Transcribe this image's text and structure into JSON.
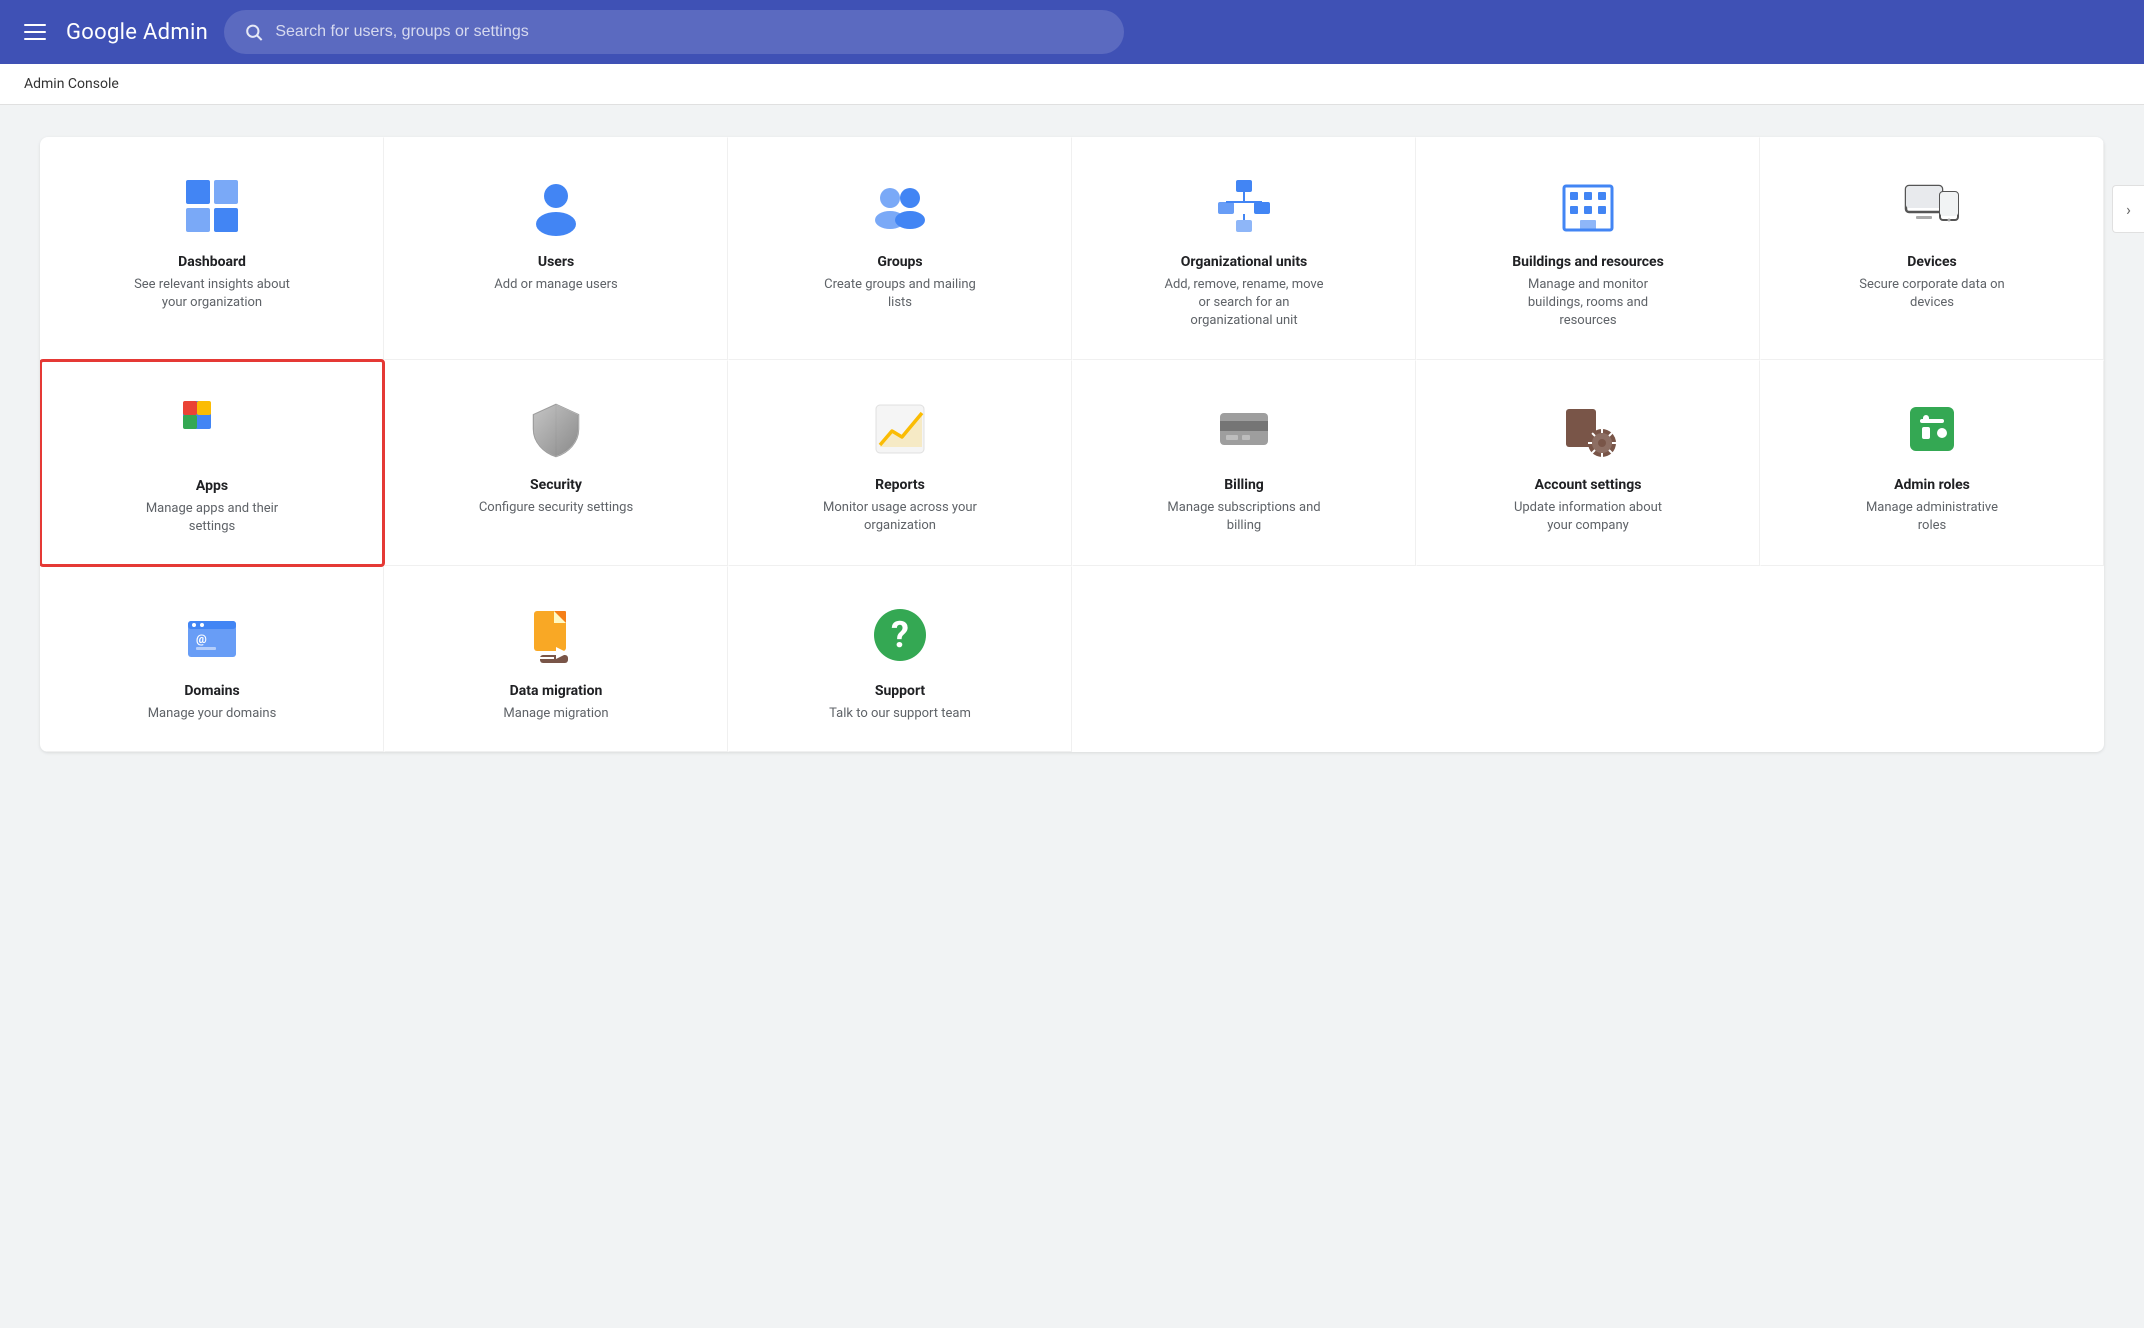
{
  "header": {
    "menu_label": "Menu",
    "logo": "Google Admin",
    "search_placeholder": "Search for users, groups or settings"
  },
  "breadcrumb": "Admin Console",
  "chevron": "›",
  "grid": {
    "items": [
      {
        "id": "dashboard",
        "title": "Dashboard",
        "desc": "See relevant insights about your organization",
        "selected": false,
        "icon": "dashboard"
      },
      {
        "id": "users",
        "title": "Users",
        "desc": "Add or manage users",
        "selected": false,
        "icon": "users"
      },
      {
        "id": "groups",
        "title": "Groups",
        "desc": "Create groups and mailing lists",
        "selected": false,
        "icon": "groups"
      },
      {
        "id": "org-units",
        "title": "Organizational units",
        "desc": "Add, remove, rename, move or search for an organizational unit",
        "selected": false,
        "icon": "org-units"
      },
      {
        "id": "buildings",
        "title": "Buildings and resources",
        "desc": "Manage and monitor buildings, rooms and resources",
        "selected": false,
        "icon": "buildings"
      },
      {
        "id": "devices",
        "title": "Devices",
        "desc": "Secure corporate data on devices",
        "selected": false,
        "icon": "devices"
      },
      {
        "id": "apps",
        "title": "Apps",
        "desc": "Manage apps and their settings",
        "selected": true,
        "icon": "apps"
      },
      {
        "id": "security",
        "title": "Security",
        "desc": "Configure security settings",
        "selected": false,
        "icon": "security"
      },
      {
        "id": "reports",
        "title": "Reports",
        "desc": "Monitor usage across your organization",
        "selected": false,
        "icon": "reports"
      },
      {
        "id": "billing",
        "title": "Billing",
        "desc": "Manage subscriptions and billing",
        "selected": false,
        "icon": "billing"
      },
      {
        "id": "account-settings",
        "title": "Account settings",
        "desc": "Update information about your company",
        "selected": false,
        "icon": "account-settings"
      },
      {
        "id": "admin-roles",
        "title": "Admin roles",
        "desc": "Manage administrative roles",
        "selected": false,
        "icon": "admin-roles"
      },
      {
        "id": "domains",
        "title": "Domains",
        "desc": "Manage your domains",
        "selected": false,
        "icon": "domains"
      },
      {
        "id": "data-migration",
        "title": "Data migration",
        "desc": "Manage migration",
        "selected": false,
        "icon": "data-migration"
      },
      {
        "id": "support",
        "title": "Support",
        "desc": "Talk to our support team",
        "selected": false,
        "icon": "support"
      }
    ]
  }
}
